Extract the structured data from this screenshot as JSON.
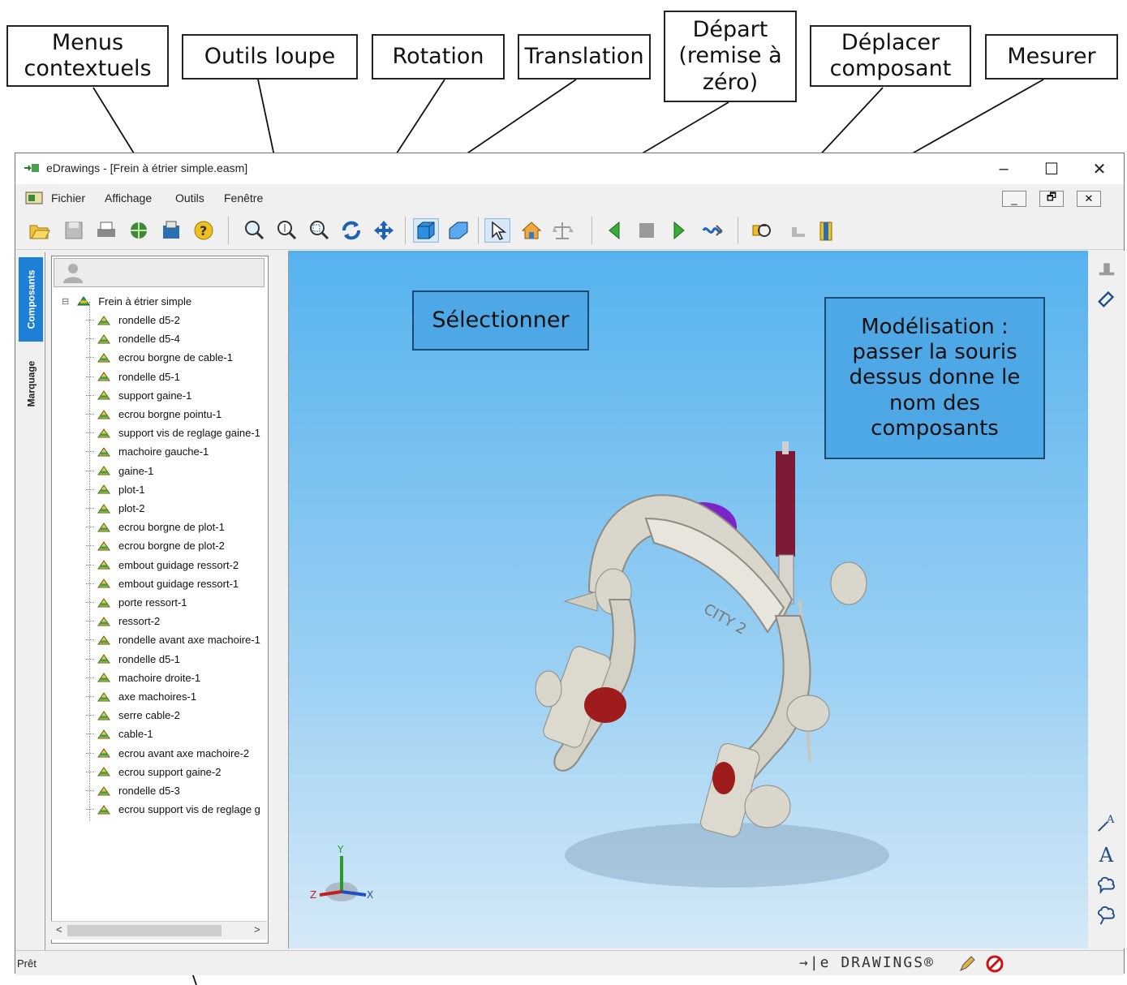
{
  "callouts": {
    "menus": "Menus\ncontextuels",
    "loupe": "Outils loupe",
    "rotation": "Rotation",
    "translation": "Translation",
    "depart": "Départ\n(remise à\nzéro)",
    "deplacer": "Déplacer\ncomposant",
    "mesurer": "Mesurer",
    "selectionner": "Sélectionner",
    "modelisation": "Modélisation :\npasser la souris\ndessus donne le\nnom des\ncomposants"
  },
  "window": {
    "title": "eDrawings - [Frein à étrier simple.easm]",
    "controls": {
      "minimize": "–",
      "maximize": "☐",
      "close": "✕"
    },
    "mdi": {
      "minimize": "_",
      "restore": "🗗",
      "close": "✕"
    }
  },
  "menu": [
    "Fichier",
    "Affichage",
    "Outils",
    "Fenêtre"
  ],
  "tabs": {
    "components": "Composants",
    "markup": "Marquage"
  },
  "tree": {
    "root": "Frein à étrier simple",
    "items": [
      "rondelle d5-2",
      "rondelle d5-4",
      "ecrou borgne de cable-1",
      "rondelle d5-1",
      "support gaine-1",
      "ecrou borgne pointu-1",
      "support vis de reglage gaine-1",
      "machoire gauche-1",
      "gaine-1",
      "plot-1",
      "plot-2",
      "ecrou borgne de plot-1",
      "ecrou borgne de plot-2",
      "embout guidage ressort-2",
      "embout guidage ressort-1",
      "porte ressort-1",
      "ressort-2",
      "rondelle avant axe machoire-1",
      "rondelle d5-1",
      "machoire droite-1",
      "axe machoires-1",
      "serre cable-2",
      "cable-1",
      "ecrou avant axe machoire-2",
      "ecrou support gaine-2",
      "rondelle d5-3",
      "ecrou support vis de reglage g"
    ]
  },
  "model_text": "CITY 2",
  "triad": {
    "x": "X",
    "y": "Y",
    "z": "Z"
  },
  "status": {
    "text": "Prêt",
    "brand": "→|e DRAWINGS®"
  },
  "scroll": {
    "left": "<",
    "right": ">"
  },
  "colors": {
    "viewport_top": "#56b2ee",
    "callout_blue": "#4fa8e6",
    "brake_body": "#d9d6cc",
    "pad_red": "#9e1c1c",
    "cable_sleeve": "#7a1a35",
    "nut_purple": "#7b22c8"
  }
}
